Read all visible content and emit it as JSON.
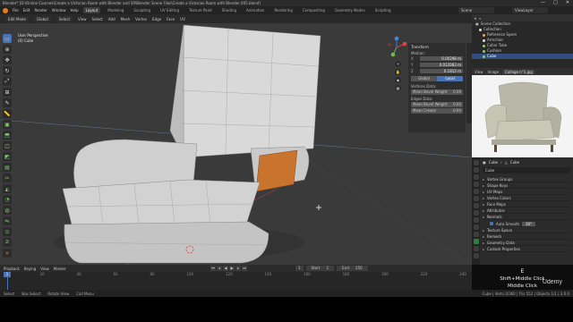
{
  "title_bar": {
    "text": "Blender* [D:\\Online Courses\\Create a Victorian Room with Blender and SP\\Blender Scene Files\\Create a Victorian Room with Blender 005.blend]",
    "controls": [
      "—",
      "□",
      "✕"
    ]
  },
  "menu": {
    "items": [
      "File",
      "Edit",
      "Render",
      "Window",
      "Help"
    ],
    "workspaces": [
      "Layout",
      "Modeling",
      "Sculpting",
      "UV Editing",
      "Texture Paint",
      "Shading",
      "Animation",
      "Rendering",
      "Compositing",
      "Geometry Nodes",
      "Scripting"
    ],
    "active_workspace": "Layout",
    "scene": "Scene",
    "view_layer": "ViewLayer"
  },
  "viewport": {
    "header": {
      "mode": "Edit Mode",
      "orientation": "Global",
      "select": "Select",
      "menus": [
        "View",
        "Select",
        "Add",
        "Mesh",
        "Vertex",
        "Edge",
        "Face",
        "UV"
      ]
    },
    "info_line1": "User Perspective",
    "info_line2": "(0) Cube",
    "tools": [
      {
        "icon": "select-box-icon",
        "glyph": "▭",
        "active": true
      },
      {
        "icon": "cursor-icon",
        "glyph": "⊕"
      },
      {
        "icon": "move-icon",
        "glyph": "✥"
      },
      {
        "icon": "rotate-icon",
        "glyph": "↻"
      },
      {
        "icon": "scale-icon",
        "glyph": "⤢"
      },
      {
        "icon": "transform-icon",
        "glyph": "⊞"
      },
      {
        "icon": "annotate-icon",
        "glyph": "✎"
      },
      {
        "icon": "measure-icon",
        "glyph": "📏"
      },
      {
        "icon": "add-cube-icon",
        "glyph": "▣",
        "color": "green"
      },
      {
        "icon": "extrude-icon",
        "glyph": "⬒",
        "color": "green"
      },
      {
        "icon": "inset-icon",
        "glyph": "◫",
        "color": "green"
      },
      {
        "icon": "bevel-icon",
        "glyph": "◩",
        "color": "green"
      },
      {
        "icon": "loop-cut-icon",
        "glyph": "▤",
        "color": "green"
      },
      {
        "icon": "knife-icon",
        "glyph": "✂",
        "color": "green"
      },
      {
        "icon": "poly-build-icon",
        "glyph": "◭",
        "color": "green"
      },
      {
        "icon": "spin-icon",
        "glyph": "◔",
        "color": "green"
      },
      {
        "icon": "smooth-icon",
        "glyph": "◍",
        "color": "green"
      },
      {
        "icon": "edge-slide-icon",
        "glyph": "⇋",
        "color": "green"
      },
      {
        "icon": "shrink-icon",
        "glyph": "⊙",
        "color": "green"
      },
      {
        "icon": "shear-icon",
        "glyph": "⧄",
        "color": "green"
      },
      {
        "icon": "rip-icon",
        "glyph": "✧",
        "color": "orange"
      }
    ]
  },
  "npanel": {
    "title": "Transform",
    "median_label": "Median:",
    "rows": [
      {
        "axis": "X",
        "value": "0.00298 m"
      },
      {
        "axis": "Y",
        "value": "0.012083 m"
      },
      {
        "axis": "Z",
        "value": "0.1812 m"
      }
    ],
    "toggle": [
      "Global",
      "Local"
    ],
    "vertices_data": "Vertices Data:",
    "vertex_bevel": {
      "label": "Mean Bevel Weight",
      "value": "0.00"
    },
    "edges_data": "Edges Data:",
    "edge_bevel": {
      "label": "Mean Bevel Weight",
      "value": "0.00"
    },
    "edge_crease": {
      "label": "Mean Crease",
      "value": "0.00"
    }
  },
  "outliner": {
    "header": "Scene Collection",
    "items": [
      {
        "label": "Collection",
        "dot": "white"
      },
      {
        "label": "Reference Spere",
        "dot": "orange"
      },
      {
        "label": "Armchair",
        "dot": "white"
      },
      {
        "label": "Collar Tube",
        "dot": "green"
      },
      {
        "label": "Cushion",
        "dot": "green"
      },
      {
        "label": "Cube",
        "dot": "green",
        "selected": true
      }
    ]
  },
  "image_editor": {
    "menus": [
      "View",
      "Image"
    ],
    "image_name": "Collage n°1.jpg"
  },
  "properties": {
    "object": "Cube",
    "data": "Cube",
    "name_field": "Cube",
    "sections": [
      "Vertex Groups",
      "Shape Keys",
      "UV Maps",
      "Vertex Colors",
      "Face Maps",
      "Attributes",
      "Normals"
    ],
    "auto_smooth": {
      "label": "Auto Smooth",
      "value": "30°"
    },
    "sections2": [
      "Texture Space",
      "Remesh",
      "Geometry Data",
      "Custom Properties"
    ]
  },
  "timeline": {
    "menus": [
      "Playback",
      "Keying",
      "View",
      "Marker"
    ],
    "playback_buttons": [
      "⏮",
      "◂",
      "◀",
      "▶",
      "▸",
      "⏭"
    ],
    "start_label": "Start",
    "start": "1",
    "end_label": "End",
    "end": "250",
    "current_frame": "1",
    "ruler": [
      "0",
      "20",
      "40",
      "60",
      "80",
      "100",
      "120",
      "140",
      "160",
      "180",
      "200",
      "220",
      "240"
    ]
  },
  "statusbar": {
    "items": [
      "Select",
      "Box Select",
      "Rotate View",
      "Call Menu"
    ],
    "version": "Cube | Verts 0/360 | Tris 552 | Objects 1/1 | 3.0.0"
  },
  "key_overlay": {
    "key": "E",
    "line1": "Shift+Middle Click",
    "line2": "Middle Click"
  },
  "watermark": "Udemy"
}
